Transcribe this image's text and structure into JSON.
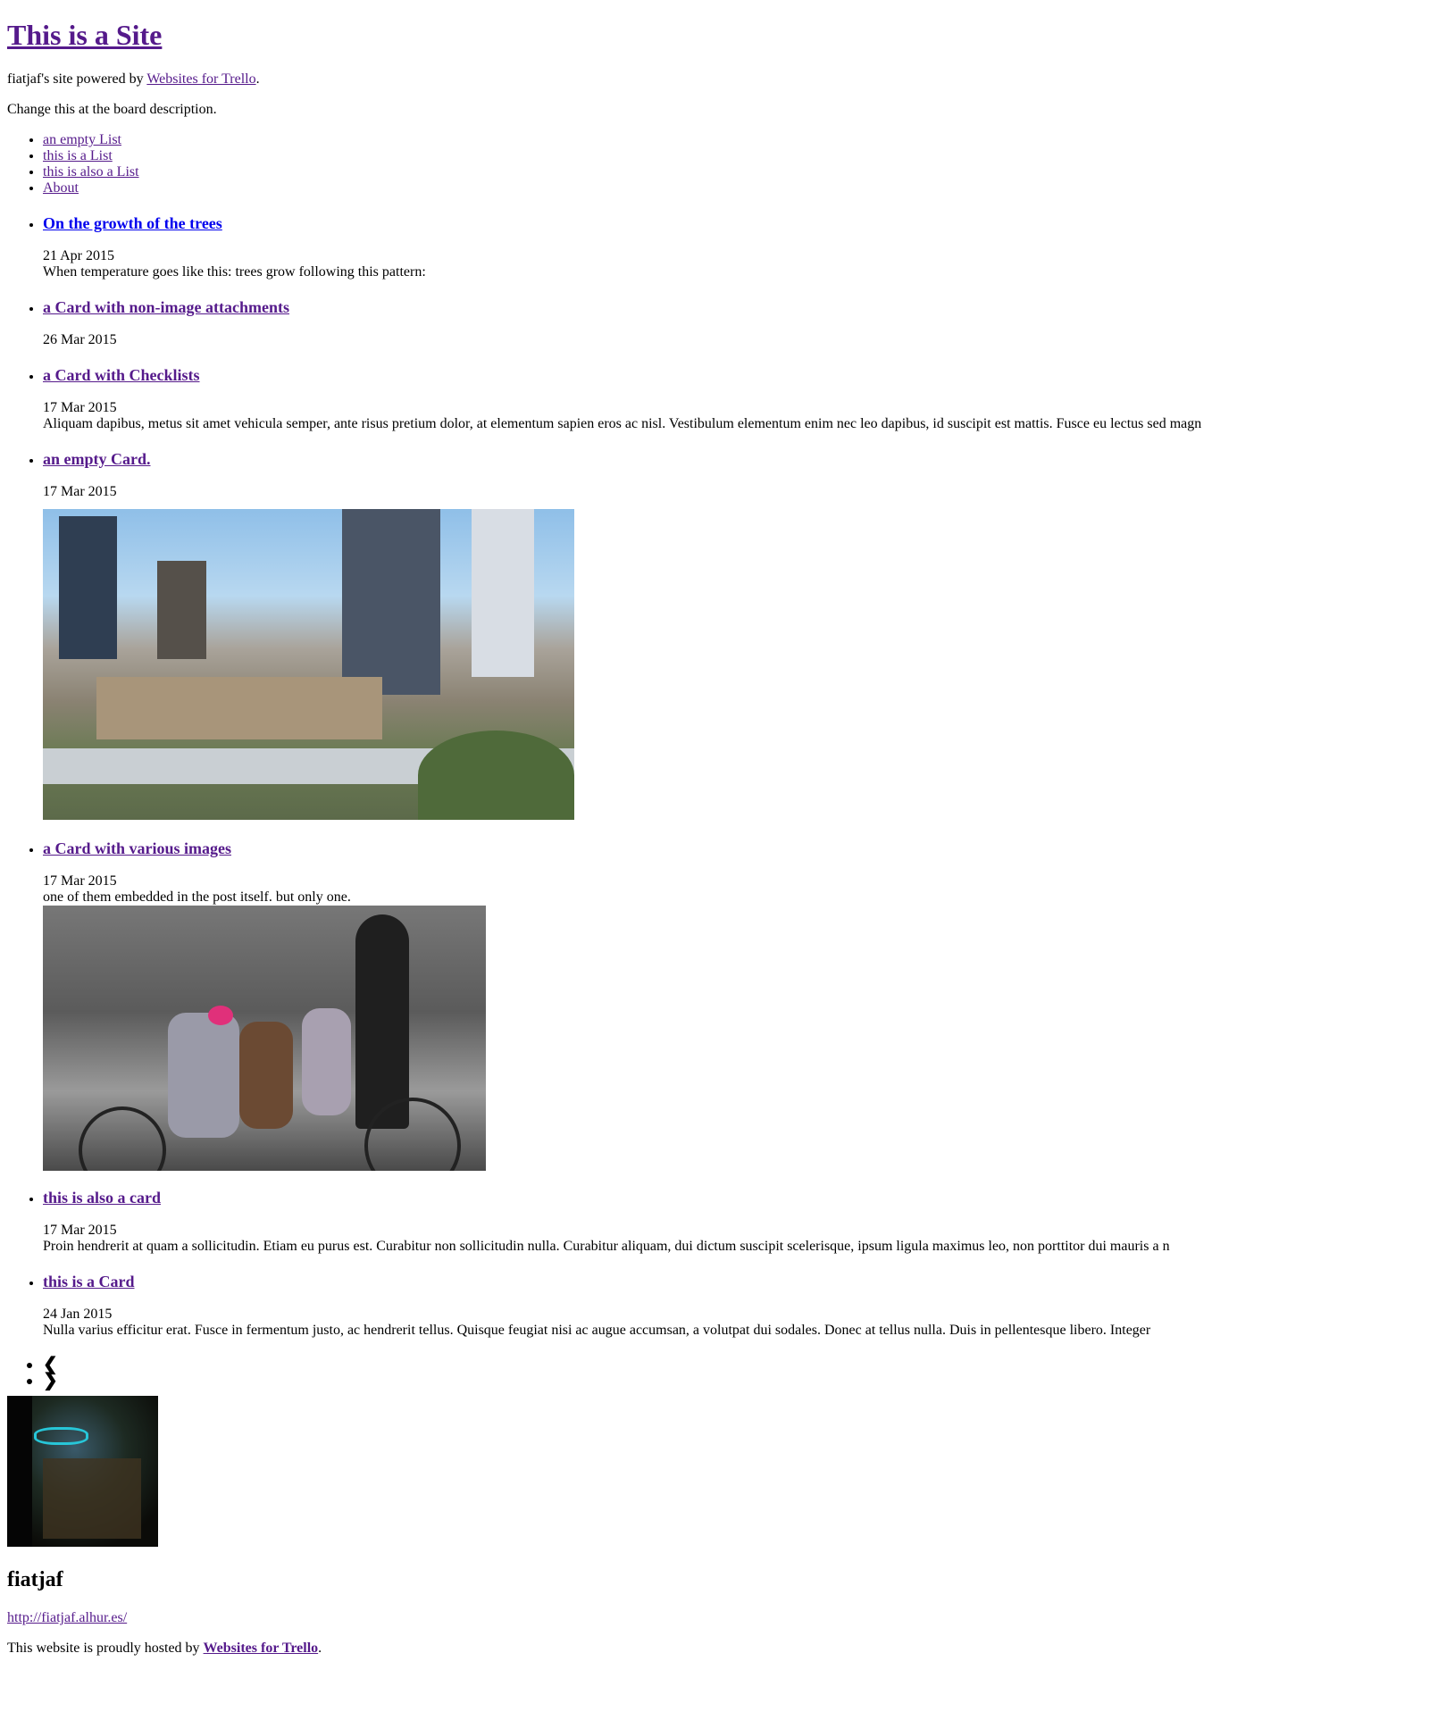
{
  "header": {
    "site_title": "This is a Site",
    "powered_prefix": "fiatjaf's site powered by ",
    "powered_link": "Websites for Trello",
    "powered_suffix": ".",
    "board_description": "Change this at the board description."
  },
  "nav": {
    "items": [
      "an empty List",
      "this is a List",
      "this is also a List",
      "About"
    ]
  },
  "cards": [
    {
      "title": "On the growth of the trees",
      "date": "21 Apr 2015",
      "excerpt": "When temperature goes like this: trees grow following this pattern:"
    },
    {
      "title": "a Card with non-image attachments",
      "date": "26 Mar 2015",
      "excerpt": ""
    },
    {
      "title": "a Card with Checklists",
      "date": "17 Mar 2015",
      "excerpt": "Aliquam dapibus, metus sit amet vehicula semper, ante risus pretium dolor, at elementum sapien eros ac nisl. Vestibulum elementum enim nec leo dapibus, id suscipit est mattis. Fusce eu lectus sed magn"
    },
    {
      "title": "an empty Card.",
      "date": "17 Mar 2015",
      "excerpt": ""
    },
    {
      "title": "a Card with various images",
      "date": "17 Mar 2015",
      "excerpt": "one of them embedded in the post itself. but only one."
    },
    {
      "title": "this is also a card",
      "date": "17 Mar 2015",
      "excerpt": "Proin hendrerit at quam a sollicitudin. Etiam eu purus est. Curabitur non sollicitudin nulla. Curabitur aliquam, dui dictum suscipit scelerisque, ipsum ligula maximus leo, non porttitor dui mauris a n"
    },
    {
      "title": "this is a Card",
      "date": "24 Jan 2015",
      "excerpt": "Nulla varius efficitur erat. Fusce in fermentum justo, ac hendrerit tellus. Quisque feugiat nisi ac augue accumsan, a volutpat dui sodales. Donec at tellus nulla. Duis in pellentesque libero. Integer"
    }
  ],
  "pager": {
    "prev": "❮",
    "next": "❯"
  },
  "footer": {
    "author_name": "fiatjaf",
    "author_url": "http://fiatjaf.alhur.es/",
    "hosted_prefix": "This website is proudly hosted by ",
    "hosted_link": "Websites for Trello",
    "hosted_suffix": "."
  },
  "colors": {
    "visited_link": "#551a8b",
    "unvisited_link": "#0000ee",
    "text": "#000000"
  }
}
